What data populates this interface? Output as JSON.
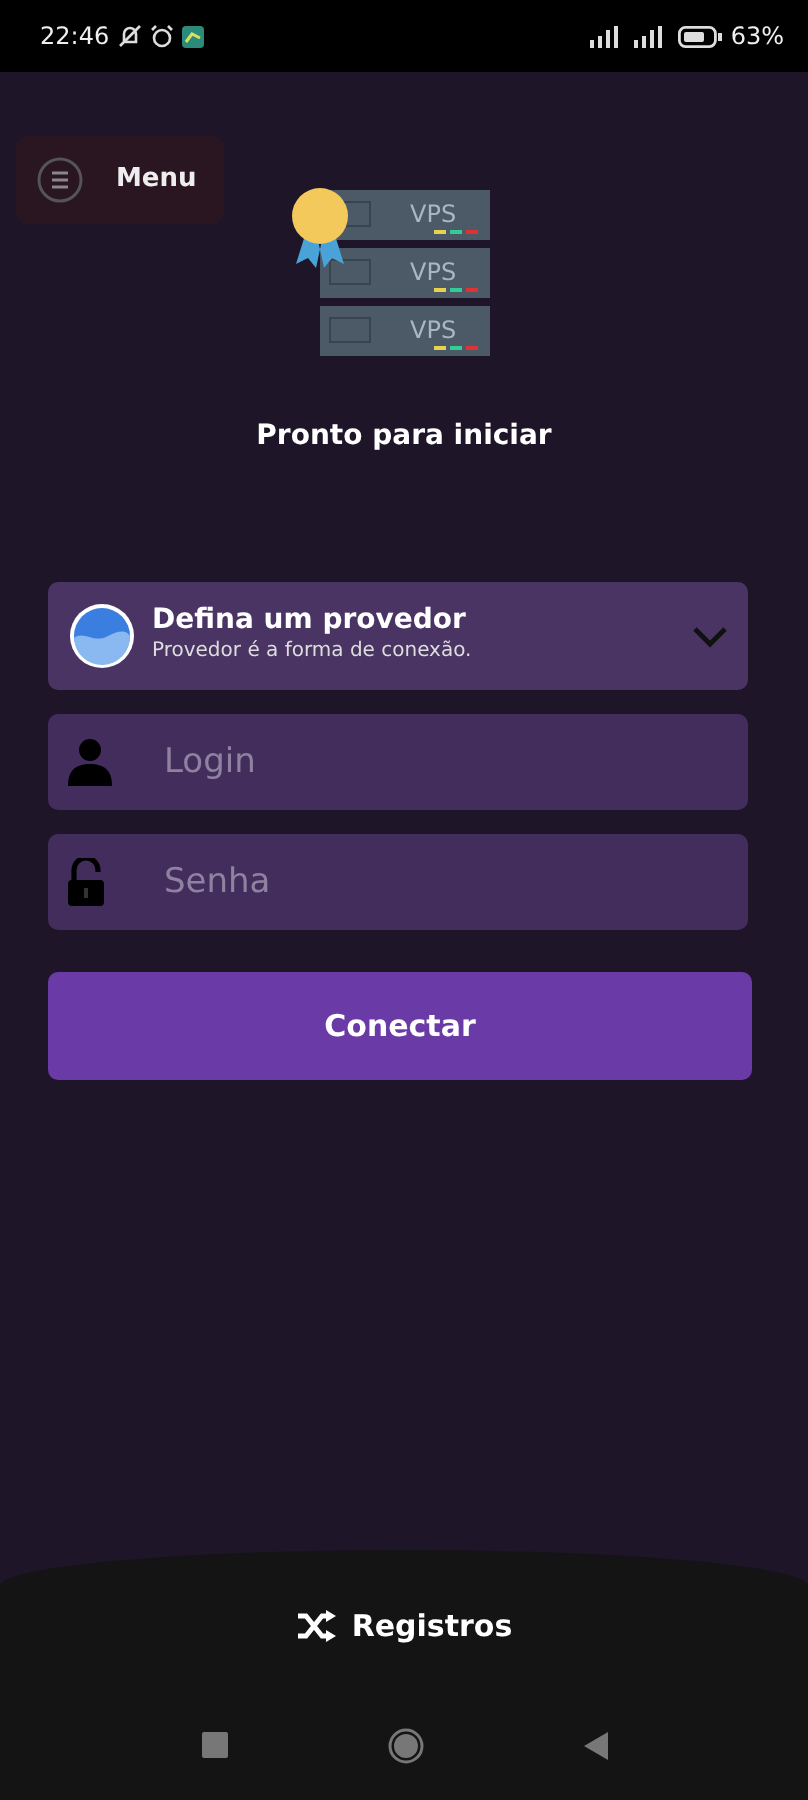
{
  "status_bar": {
    "time": "22:46",
    "battery": "63%"
  },
  "menu_button": {
    "label": "Menu"
  },
  "illustration": {
    "labels": [
      "VPS",
      "VPS",
      "VPS"
    ]
  },
  "title": "Pronto para iniciar",
  "provider": {
    "title": "Defina um provedor",
    "subtitle": "Provedor é a forma de conexão."
  },
  "fields": [
    {
      "kind": "user",
      "placeholder": "Login"
    },
    {
      "kind": "lock",
      "placeholder": "Senha"
    }
  ],
  "connect_button": {
    "label": "Conectar"
  },
  "footer": {
    "label": "Registros"
  }
}
